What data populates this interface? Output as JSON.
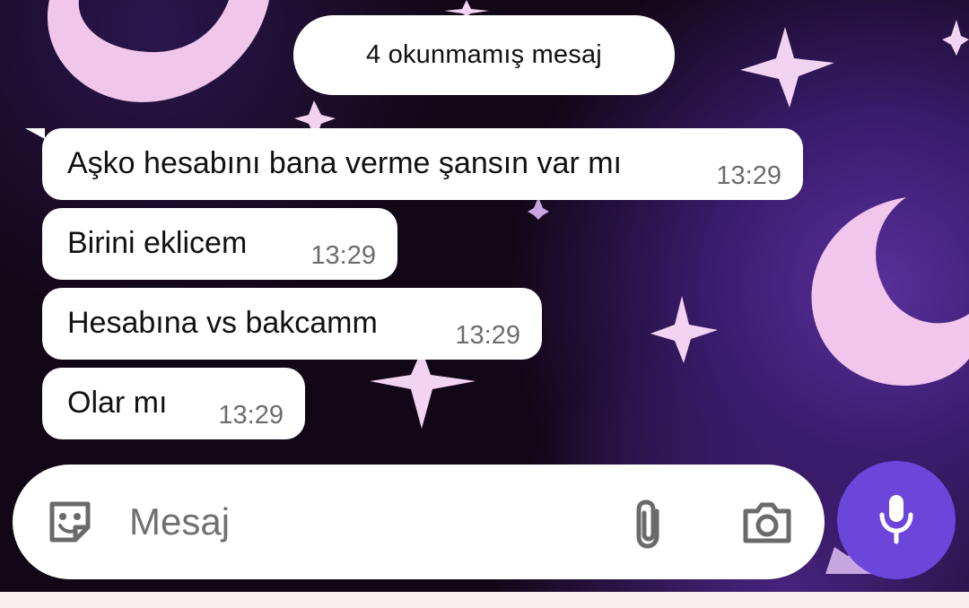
{
  "banner": {
    "unread_text": "4 okunmamış mesaj"
  },
  "messages": [
    {
      "text": "Aşko hesabını bana verme şansın var mı",
      "time": "13:29"
    },
    {
      "text": "Birini eklicem",
      "time": "13:29"
    },
    {
      "text": "Hesabına vs bakcamm",
      "time": "13:29"
    },
    {
      "text": "Olar mı",
      "time": "13:29"
    }
  ],
  "composer": {
    "placeholder": "Mesaj",
    "icons": [
      "sticker-icon",
      "attach-icon",
      "camera-icon",
      "mic-icon"
    ]
  },
  "colors": {
    "accent": "#6c46db",
    "wallpaper": "#120716",
    "bubble": "#ffffff",
    "time_text": "#6c6c6c"
  }
}
